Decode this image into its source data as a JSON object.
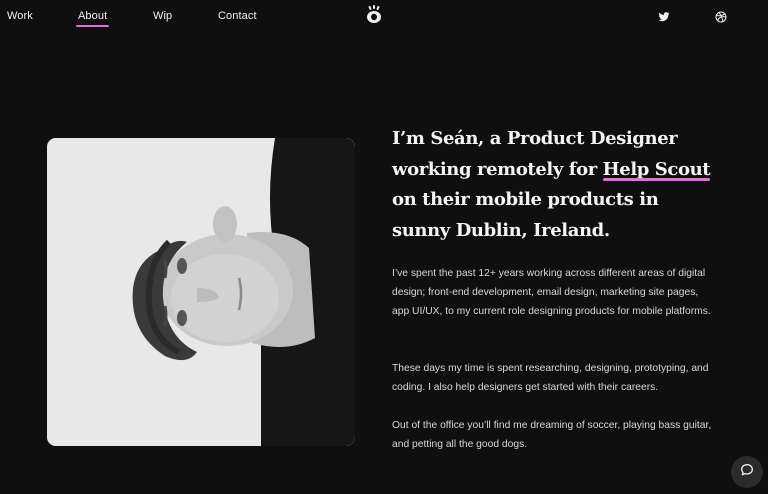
{
  "nav": {
    "items": [
      {
        "label": "Work",
        "active": false
      },
      {
        "label": "About",
        "active": true
      },
      {
        "label": "Wip",
        "active": false
      },
      {
        "label": "Contact",
        "active": false
      }
    ],
    "logo_icon": "eye-logo-icon",
    "social": [
      "twitter-icon",
      "dribbble-icon"
    ]
  },
  "colors": {
    "background": "#0f0f0f",
    "accent": "#e36fd6",
    "text": "#e9e9e9"
  },
  "intro": {
    "before_link": "I’m Seán, a Product Designer working remotely for ",
    "link": "Help Scout",
    "after_link": " on their mobile products in sunny Dublin, Ireland."
  },
  "paragraphs": [
    "I’ve spent the past 12+ years working across different areas of digital design; front-end development, email design, marketing site pages, app UI/UX, to my current role designing products for mobile platforms.",
    "These days my time is spent researching, designing, prototyping, and coding. I also help designers get started with their careers.",
    "Out of the office you’ll find me dreaming of soccer, playing bass guitar, and petting all the good dogs."
  ],
  "chat_icon": "chat-bubble-icon"
}
